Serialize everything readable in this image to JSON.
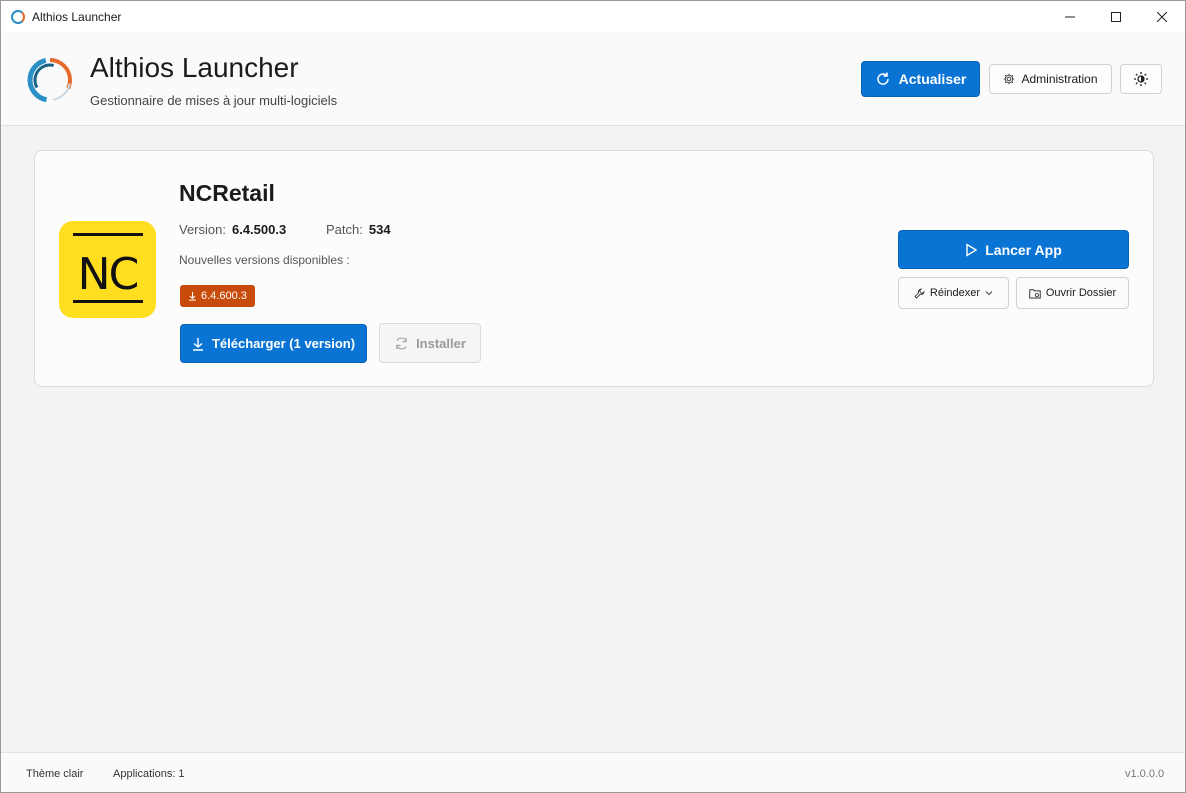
{
  "window": {
    "title": "Althios Launcher",
    "controls": {
      "minimize": "—",
      "maximize": "☐",
      "close": "✕"
    }
  },
  "devtoolbar": {
    "icons": [
      "live-visual-tree-icon",
      "record-icon",
      "select-element-icon",
      "display-layout-adorners-icon",
      "track-focus-icon",
      "hot-reload-icon",
      "accessibility-icon",
      "check-icon",
      "collapse-chevron-icon"
    ]
  },
  "header": {
    "title": "Althios Launcher",
    "subtitle": "Gestionnaire de mises à jour multi-logiciels",
    "refresh_label": "Actualiser",
    "admin_label": "Administration",
    "theme_icon": "sun-icon"
  },
  "app_card": {
    "name": "NCRetail",
    "logo_text": "NC",
    "version_label": "Version:",
    "version_value": "6.4.500.3",
    "patch_label": "Patch:",
    "patch_value": "534",
    "available_label": "Nouvelles versions disponibles :",
    "available_versions": [
      "6.4.600.3"
    ],
    "download_label": "Télécharger (1 version)",
    "install_label": "Installer",
    "launch_label": "Lancer App",
    "reindex_label": "Réindexer",
    "open_folder_label": "Ouvrir Dossier"
  },
  "footer": {
    "theme_label": "Thème clair",
    "apps_count_label": "Applications: 1",
    "app_version": "v1.0.0.0"
  },
  "colors": {
    "accent": "#0a74d4",
    "badge": "#c94b0c",
    "nc_yellow": "#ffde1f"
  }
}
